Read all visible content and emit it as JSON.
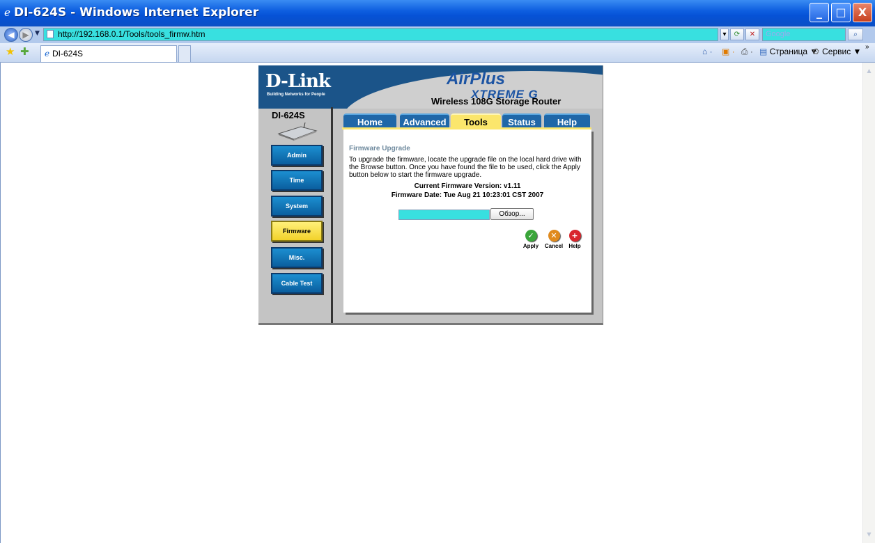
{
  "window": {
    "title": "DI-624S - Windows Internet Explorer",
    "min": "_",
    "max": "□",
    "close": "X"
  },
  "address": {
    "url": "http://192.168.0.1/Tools/tools_firmw.htm",
    "search_placeholder": "Google"
  },
  "tabs": {
    "current": "DI-624S"
  },
  "toolbar": {
    "page": "Страница ▼",
    "tools": "Сервис ▼"
  },
  "router": {
    "brand": "D-Link",
    "brand_sub": "Building Networks for People",
    "product_line_1": "Air",
    "product_line_2": "Plus",
    "product_line_3": "XTREME G",
    "product_title": "Wireless 108G Storage Router",
    "model": "DI-624S",
    "side_buttons": [
      "Admin",
      "Time",
      "System",
      "Firmware",
      "Misc.",
      "Cable Test"
    ],
    "active_side": "Firmware",
    "nav_tabs": [
      "Home",
      "Advanced",
      "Tools",
      "Status",
      "Help"
    ],
    "active_tab": "Tools",
    "content": {
      "heading": "Firmware Upgrade",
      "description": "To upgrade the firmware, locate the upgrade file on the local hard drive with the Browse button. Once you have found the file to be used, click the Apply button below to start the firmware upgrade.",
      "current_version": "Current Firmware Version: v1.11",
      "firmware_date": "Firmware Date: Tue Aug 21 10:23:01 CST 2007",
      "browse_label": "Обзор...",
      "apply": "Apply",
      "cancel": "Cancel",
      "help": "Help"
    }
  },
  "colors": {
    "accent_cyan": "#38e0e0",
    "router_blue": "#1b5489",
    "tab_yellow": "#fbe66c"
  }
}
